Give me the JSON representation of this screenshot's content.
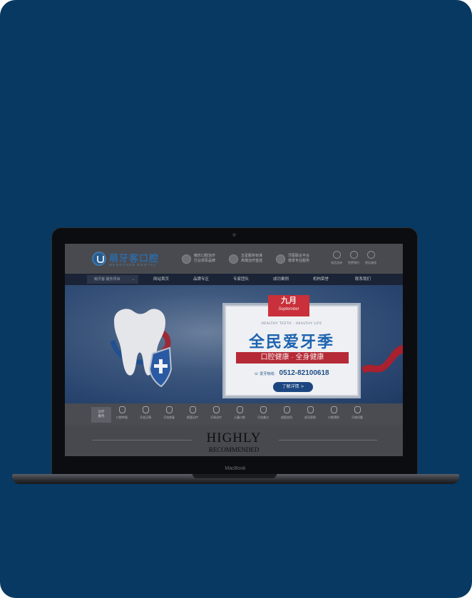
{
  "site": {
    "logo_text": "萌牙客口腔",
    "logo_sub": "MENGYAKE DENTAL",
    "features": [
      {
        "icon": "tooth-shield-icon",
        "line1": "萌乐口腔治疗",
        "line2": "行业领军品牌"
      },
      {
        "icon": "stethoscope-icon",
        "line1": "五星服务标准",
        "line2": "高端治疗首选"
      },
      {
        "icon": "badge-icon",
        "line1": "牙医联合平台",
        "line2": "尊享专业服务"
      }
    ],
    "quick_links": [
      {
        "icon": "phone-icon",
        "label": "电话咨询"
      },
      {
        "icon": "chat-icon",
        "label": "免费预约"
      },
      {
        "icon": "location-icon",
        "label": "院址路线"
      }
    ]
  },
  "nav": {
    "select_label": "萌牙客·服务项目",
    "items": [
      "网站首页",
      "品牌专区",
      "专家团队",
      "成功案例",
      "机构荣誉",
      "联系我们"
    ]
  },
  "banner": {
    "month_cn": "九月",
    "month_en": "September",
    "tagline": "HEALTHY TEETH · HEALTHY LIFE",
    "title": "全民爱牙季",
    "ribbon": "口腔健康 · 全身健康",
    "hotline_label": "爱牙热线:",
    "hotline_number": "0512-82100618",
    "button": "了解详情 >",
    "slide_count": 6,
    "active_slide": 1
  },
  "services": {
    "active_label_1": "诊疗",
    "active_label_2": "服务",
    "items": [
      "口腔种植",
      "牙齿正畸",
      "牙齿修复",
      "根管治疗",
      "牙周治疗",
      "儿童口腔",
      "牙齿美白",
      "拔智齿科",
      "成功案例",
      "口腔预防",
      "牙病问题"
    ]
  },
  "lower": {
    "heading_1": "HIGHLY",
    "heading_2": "RECOMMENDED"
  },
  "device": {
    "brand": "MacBook"
  },
  "colors": {
    "background": "#083963",
    "accent_blue": "#1d63b0",
    "accent_red": "#c9303b"
  }
}
